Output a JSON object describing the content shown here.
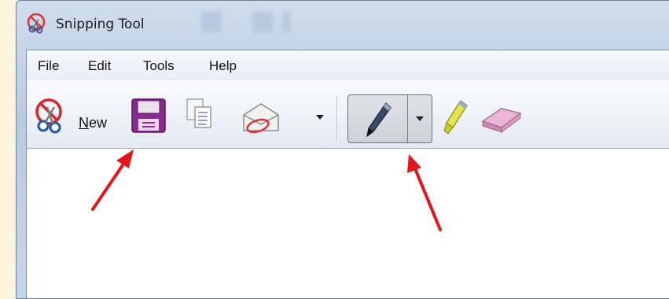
{
  "window": {
    "title": "Snipping Tool",
    "background_color": "#fdf2dc"
  },
  "menubar": {
    "items": [
      {
        "label": "File"
      },
      {
        "label": "Edit"
      },
      {
        "label": "Tools"
      },
      {
        "label": "Help"
      }
    ]
  },
  "toolbar": {
    "new_label_mnemonic": "N",
    "new_label_rest": "ew",
    "icons": {
      "new": "scissors-icon",
      "save": "floppy-disk-icon",
      "copy": "copy-icon",
      "send": "envelope-icon",
      "send_dropdown": "chevron-down-icon",
      "pen": "pen-icon",
      "pen_dropdown": "chevron-down-icon",
      "highlighter": "highlighter-icon",
      "eraser": "eraser-icon"
    },
    "save_color": "#8a2a8f"
  },
  "annotations": {
    "arrow_color": "#e8141b",
    "arrows": [
      "arrow-to-save-button",
      "arrow-to-pen-tool"
    ]
  }
}
